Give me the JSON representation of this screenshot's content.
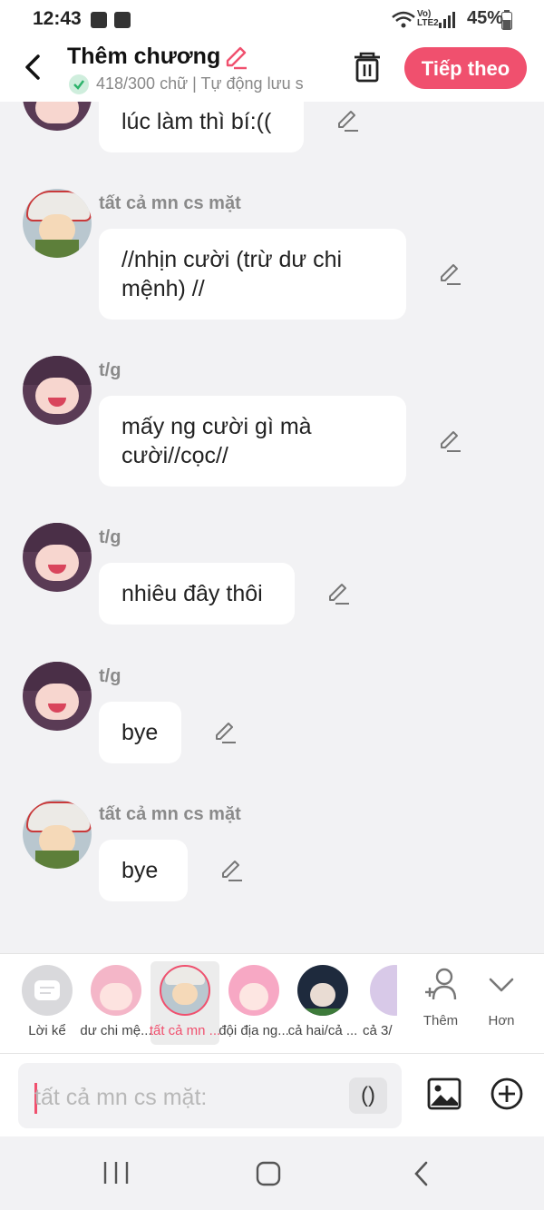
{
  "status": {
    "time": "12:43",
    "battery": "45%",
    "net": "Vo) LTE2"
  },
  "header": {
    "title": "Thêm chương",
    "subtitle": "418/300 chữ | Tự động lưu s",
    "next_label": "Tiếp theo"
  },
  "messages": [
    {
      "text": "lúc làm thì bí:(("
    },
    {
      "name": "tất cả mn cs mặt",
      "text": "//nhịn cười (trừ dư chi mệnh) //"
    },
    {
      "name": "t/g",
      "text": "mấy ng cười gì mà cười//cọc//"
    },
    {
      "name": "t/g",
      "text": "nhiêu đây thôi"
    },
    {
      "name": "t/g",
      "text": "bye"
    },
    {
      "name": "tất cả mn cs mặt",
      "text": "bye"
    }
  ],
  "characters": [
    {
      "label": "Lời kể"
    },
    {
      "label": "dư chi mệ..."
    },
    {
      "label": "tất cả mn ..."
    },
    {
      "label": "đội địa ng..."
    },
    {
      "label": "cả hai/cả ..."
    },
    {
      "label": "cả 3/"
    }
  ],
  "actions": {
    "add_label": "Thêm",
    "more_label": "Hơn"
  },
  "input": {
    "placeholder": "tất cả mn cs mặt:",
    "paren_label": "()"
  },
  "colors": {
    "accent": "#f0506e",
    "background": "#f2f2f4"
  }
}
